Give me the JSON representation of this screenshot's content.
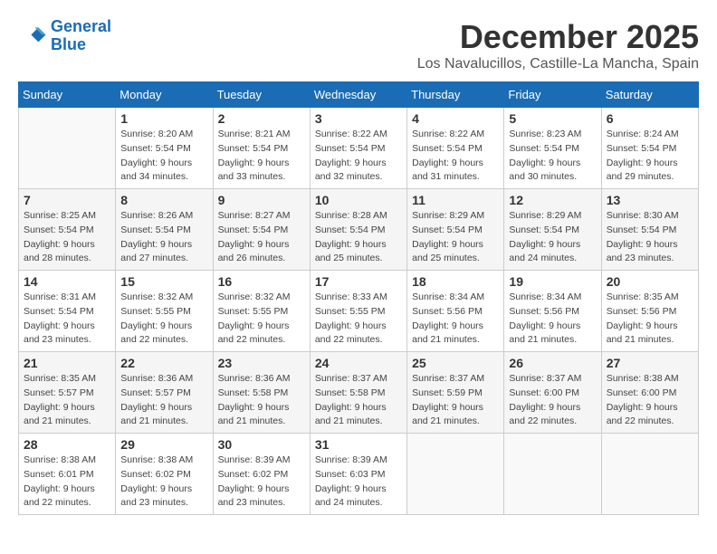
{
  "header": {
    "logo_line1": "General",
    "logo_line2": "Blue",
    "month_title": "December 2025",
    "location": "Los Navalucillos, Castille-La Mancha, Spain"
  },
  "weekdays": [
    "Sunday",
    "Monday",
    "Tuesday",
    "Wednesday",
    "Thursday",
    "Friday",
    "Saturday"
  ],
  "weeks": [
    {
      "shaded": false,
      "days": [
        {
          "num": "",
          "sunrise": "",
          "sunset": "",
          "daylight": "",
          "empty": true
        },
        {
          "num": "1",
          "sunrise": "Sunrise: 8:20 AM",
          "sunset": "Sunset: 5:54 PM",
          "daylight": "Daylight: 9 hours and 34 minutes."
        },
        {
          "num": "2",
          "sunrise": "Sunrise: 8:21 AM",
          "sunset": "Sunset: 5:54 PM",
          "daylight": "Daylight: 9 hours and 33 minutes."
        },
        {
          "num": "3",
          "sunrise": "Sunrise: 8:22 AM",
          "sunset": "Sunset: 5:54 PM",
          "daylight": "Daylight: 9 hours and 32 minutes."
        },
        {
          "num": "4",
          "sunrise": "Sunrise: 8:22 AM",
          "sunset": "Sunset: 5:54 PM",
          "daylight": "Daylight: 9 hours and 31 minutes."
        },
        {
          "num": "5",
          "sunrise": "Sunrise: 8:23 AM",
          "sunset": "Sunset: 5:54 PM",
          "daylight": "Daylight: 9 hours and 30 minutes."
        },
        {
          "num": "6",
          "sunrise": "Sunrise: 8:24 AM",
          "sunset": "Sunset: 5:54 PM",
          "daylight": "Daylight: 9 hours and 29 minutes."
        }
      ]
    },
    {
      "shaded": true,
      "days": [
        {
          "num": "7",
          "sunrise": "Sunrise: 8:25 AM",
          "sunset": "Sunset: 5:54 PM",
          "daylight": "Daylight: 9 hours and 28 minutes."
        },
        {
          "num": "8",
          "sunrise": "Sunrise: 8:26 AM",
          "sunset": "Sunset: 5:54 PM",
          "daylight": "Daylight: 9 hours and 27 minutes."
        },
        {
          "num": "9",
          "sunrise": "Sunrise: 8:27 AM",
          "sunset": "Sunset: 5:54 PM",
          "daylight": "Daylight: 9 hours and 26 minutes."
        },
        {
          "num": "10",
          "sunrise": "Sunrise: 8:28 AM",
          "sunset": "Sunset: 5:54 PM",
          "daylight": "Daylight: 9 hours and 25 minutes."
        },
        {
          "num": "11",
          "sunrise": "Sunrise: 8:29 AM",
          "sunset": "Sunset: 5:54 PM",
          "daylight": "Daylight: 9 hours and 25 minutes."
        },
        {
          "num": "12",
          "sunrise": "Sunrise: 8:29 AM",
          "sunset": "Sunset: 5:54 PM",
          "daylight": "Daylight: 9 hours and 24 minutes."
        },
        {
          "num": "13",
          "sunrise": "Sunrise: 8:30 AM",
          "sunset": "Sunset: 5:54 PM",
          "daylight": "Daylight: 9 hours and 23 minutes."
        }
      ]
    },
    {
      "shaded": false,
      "days": [
        {
          "num": "14",
          "sunrise": "Sunrise: 8:31 AM",
          "sunset": "Sunset: 5:54 PM",
          "daylight": "Daylight: 9 hours and 23 minutes."
        },
        {
          "num": "15",
          "sunrise": "Sunrise: 8:32 AM",
          "sunset": "Sunset: 5:55 PM",
          "daylight": "Daylight: 9 hours and 22 minutes."
        },
        {
          "num": "16",
          "sunrise": "Sunrise: 8:32 AM",
          "sunset": "Sunset: 5:55 PM",
          "daylight": "Daylight: 9 hours and 22 minutes."
        },
        {
          "num": "17",
          "sunrise": "Sunrise: 8:33 AM",
          "sunset": "Sunset: 5:55 PM",
          "daylight": "Daylight: 9 hours and 22 minutes."
        },
        {
          "num": "18",
          "sunrise": "Sunrise: 8:34 AM",
          "sunset": "Sunset: 5:56 PM",
          "daylight": "Daylight: 9 hours and 21 minutes."
        },
        {
          "num": "19",
          "sunrise": "Sunrise: 8:34 AM",
          "sunset": "Sunset: 5:56 PM",
          "daylight": "Daylight: 9 hours and 21 minutes."
        },
        {
          "num": "20",
          "sunrise": "Sunrise: 8:35 AM",
          "sunset": "Sunset: 5:56 PM",
          "daylight": "Daylight: 9 hours and 21 minutes."
        }
      ]
    },
    {
      "shaded": true,
      "days": [
        {
          "num": "21",
          "sunrise": "Sunrise: 8:35 AM",
          "sunset": "Sunset: 5:57 PM",
          "daylight": "Daylight: 9 hours and 21 minutes."
        },
        {
          "num": "22",
          "sunrise": "Sunrise: 8:36 AM",
          "sunset": "Sunset: 5:57 PM",
          "daylight": "Daylight: 9 hours and 21 minutes."
        },
        {
          "num": "23",
          "sunrise": "Sunrise: 8:36 AM",
          "sunset": "Sunset: 5:58 PM",
          "daylight": "Daylight: 9 hours and 21 minutes."
        },
        {
          "num": "24",
          "sunrise": "Sunrise: 8:37 AM",
          "sunset": "Sunset: 5:58 PM",
          "daylight": "Daylight: 9 hours and 21 minutes."
        },
        {
          "num": "25",
          "sunrise": "Sunrise: 8:37 AM",
          "sunset": "Sunset: 5:59 PM",
          "daylight": "Daylight: 9 hours and 21 minutes."
        },
        {
          "num": "26",
          "sunrise": "Sunrise: 8:37 AM",
          "sunset": "Sunset: 6:00 PM",
          "daylight": "Daylight: 9 hours and 22 minutes."
        },
        {
          "num": "27",
          "sunrise": "Sunrise: 8:38 AM",
          "sunset": "Sunset: 6:00 PM",
          "daylight": "Daylight: 9 hours and 22 minutes."
        }
      ]
    },
    {
      "shaded": false,
      "days": [
        {
          "num": "28",
          "sunrise": "Sunrise: 8:38 AM",
          "sunset": "Sunset: 6:01 PM",
          "daylight": "Daylight: 9 hours and 22 minutes."
        },
        {
          "num": "29",
          "sunrise": "Sunrise: 8:38 AM",
          "sunset": "Sunset: 6:02 PM",
          "daylight": "Daylight: 9 hours and 23 minutes."
        },
        {
          "num": "30",
          "sunrise": "Sunrise: 8:39 AM",
          "sunset": "Sunset: 6:02 PM",
          "daylight": "Daylight: 9 hours and 23 minutes."
        },
        {
          "num": "31",
          "sunrise": "Sunrise: 8:39 AM",
          "sunset": "Sunset: 6:03 PM",
          "daylight": "Daylight: 9 hours and 24 minutes."
        },
        {
          "num": "",
          "sunrise": "",
          "sunset": "",
          "daylight": "",
          "empty": true
        },
        {
          "num": "",
          "sunrise": "",
          "sunset": "",
          "daylight": "",
          "empty": true
        },
        {
          "num": "",
          "sunrise": "",
          "sunset": "",
          "daylight": "",
          "empty": true
        }
      ]
    }
  ]
}
